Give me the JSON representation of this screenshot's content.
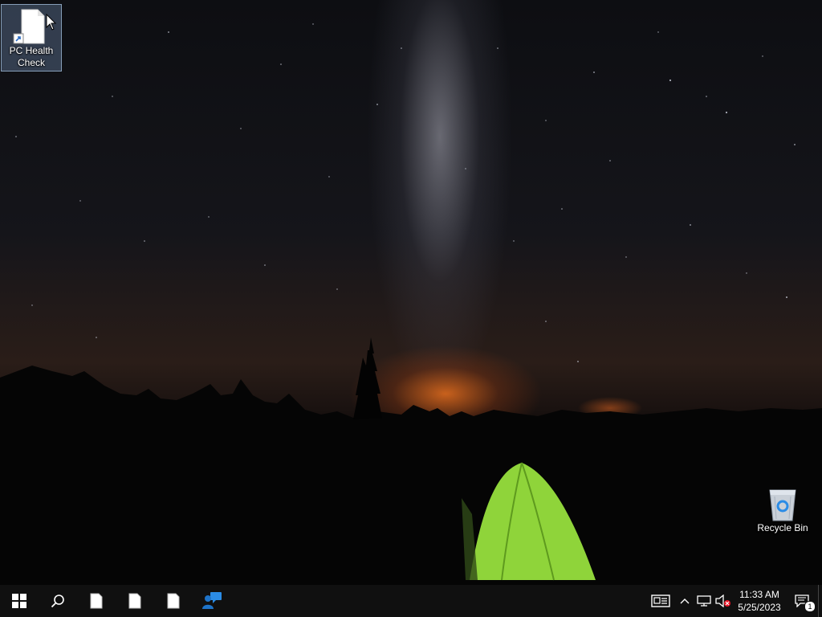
{
  "desktop": {
    "icons": [
      {
        "label": "PC Health Check",
        "icon": "blank-document-shortcut-icon",
        "selected": true
      },
      {
        "label": "Recycle Bin",
        "icon": "recycle-bin-icon",
        "selected": false
      }
    ]
  },
  "taskbar": {
    "start_icon": "windows-logo-icon",
    "search_icon": "search-icon",
    "pinned": [
      {
        "icon": "blank-document-icon"
      },
      {
        "icon": "blank-document-icon"
      },
      {
        "icon": "blank-document-icon"
      },
      {
        "icon": "quick-assist-icon"
      }
    ],
    "tray": {
      "news_icon": "news-and-interests-icon",
      "show_hidden_icon": "chevron-up-icon",
      "network_icon": "network-icon",
      "volume_icon": "volume-muted-icon",
      "time": "11:33 AM",
      "date": "5/25/2023",
      "notifications_icon": "action-center-icon",
      "notification_count": "1"
    }
  },
  "colors": {
    "taskbar": "#101010",
    "accent": "#2b8ce6",
    "tent": "#8fd43a"
  }
}
